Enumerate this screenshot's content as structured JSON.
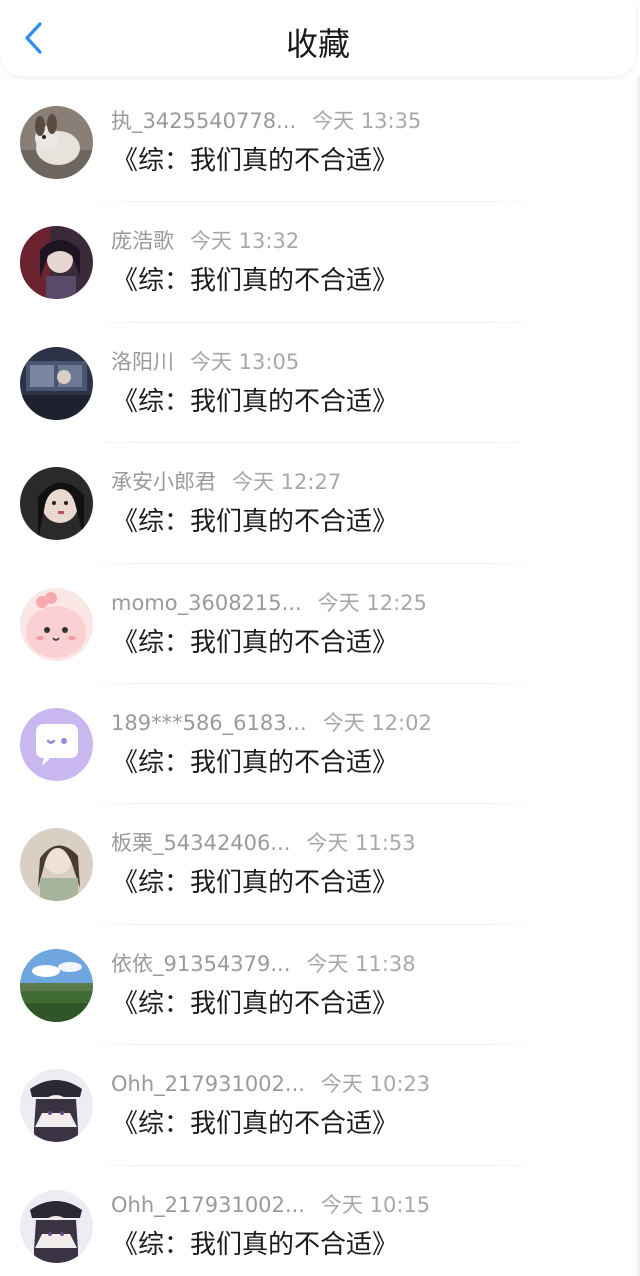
{
  "header": {
    "title": "收藏",
    "back_icon": "chevron-left-icon",
    "accent_color": "#2f8bf0"
  },
  "items": [
    {
      "name": "执_3425540778...",
      "time": "今天 13:35",
      "content": "《综：我们真的不合适》"
    },
    {
      "name": "庞浩歌",
      "time": "今天 13:32",
      "content": "《综：我们真的不合适》"
    },
    {
      "name": "洛阳川",
      "time": "今天 13:05",
      "content": "《综：我们真的不合适》"
    },
    {
      "name": "承安小郎君",
      "time": "今天 12:27",
      "content": "《综：我们真的不合适》"
    },
    {
      "name": "momo_3608215...",
      "time": "今天 12:25",
      "content": "《综：我们真的不合适》"
    },
    {
      "name": "189***586_6183...",
      "time": "今天 12:02",
      "content": "《综：我们真的不合适》"
    },
    {
      "name": "板栗_54342406...",
      "time": "今天 11:53",
      "content": "《综：我们真的不合适》"
    },
    {
      "name": "依依_91354379...",
      "time": "今天 11:38",
      "content": "《综：我们真的不合适》"
    },
    {
      "name": "Ohh_217931002...",
      "time": "今天 10:23",
      "content": "《综：我们真的不合适》"
    },
    {
      "name": "Ohh_217931002...",
      "time": "今天 10:15",
      "content": "《综：我们真的不合适》"
    }
  ]
}
